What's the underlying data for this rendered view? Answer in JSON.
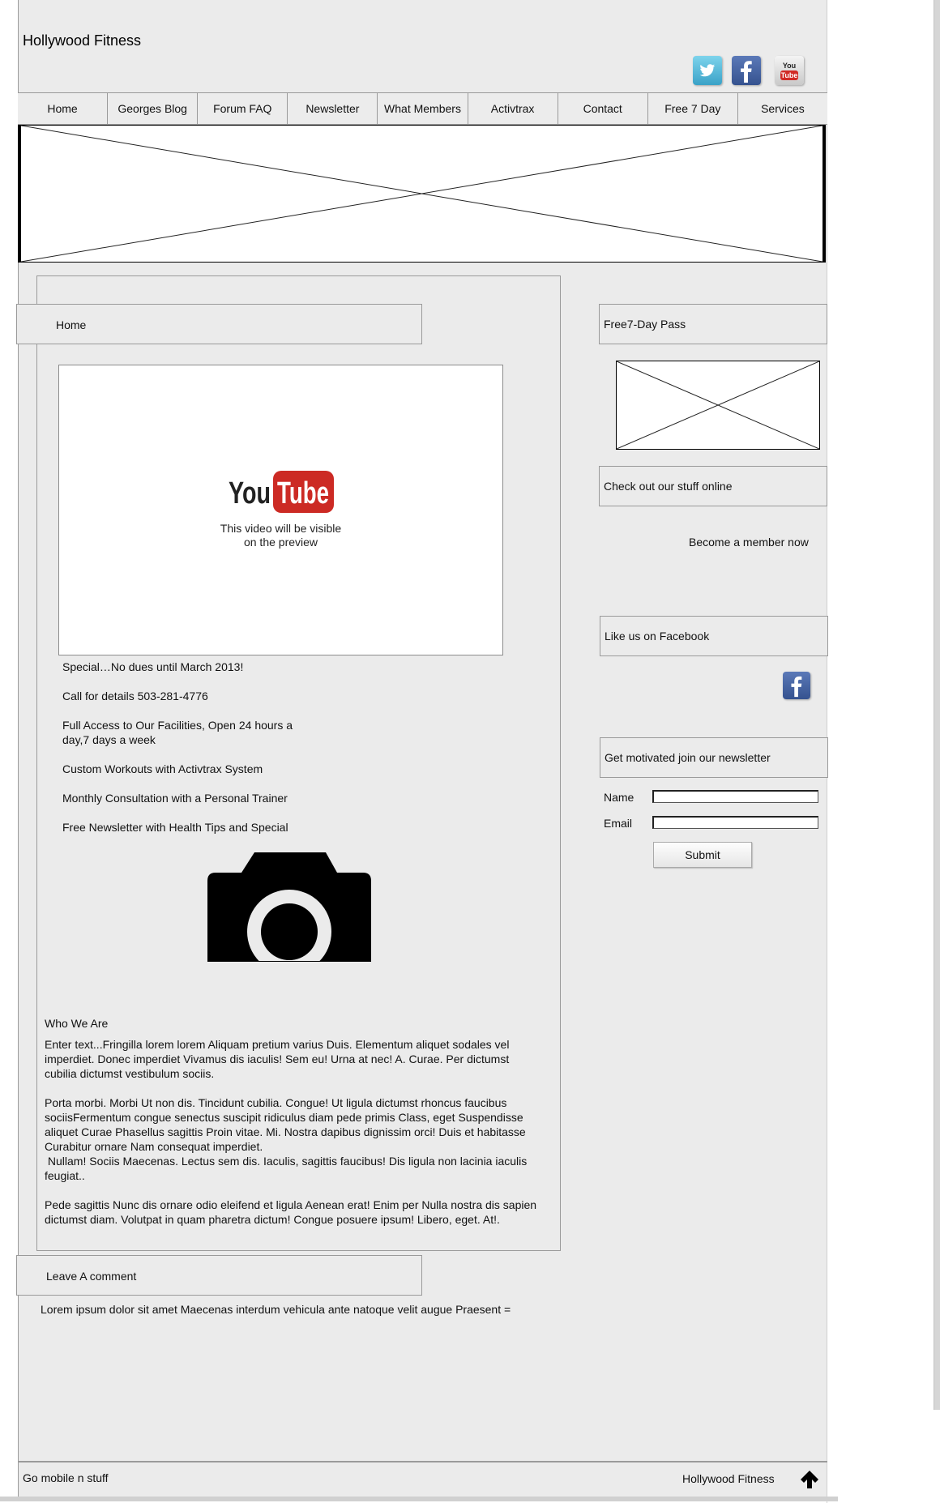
{
  "site": {
    "title": "Hollywood Fitness"
  },
  "social": [
    "twitter-icon",
    "facebook-icon",
    "youtube-icon"
  ],
  "nav": {
    "items": [
      {
        "label": "Home"
      },
      {
        "label": "Georges Blog"
      },
      {
        "label": "Forum FAQ"
      },
      {
        "label": "Newsletter"
      },
      {
        "label": "What Members"
      },
      {
        "label": "Activtrax"
      },
      {
        "label": "Contact"
      },
      {
        "label": "Free 7 Day"
      },
      {
        "label": "Services"
      }
    ]
  },
  "main": {
    "tab_label": "Home",
    "video": {
      "logo": "You Tube",
      "caption_line1": "This video will be visible",
      "caption_line2": "on the preview"
    },
    "features": [
      "Special…No dues until March 2013!",
      "Call for details  503-281-4776",
      "Full Access to Our Facilities, Open 24 hours a day,7 days a week",
      "Custom Workouts with Activtrax System",
      "Monthly Consultation with a Personal Trainer",
      "Free Newsletter with Health Tips and Special"
    ],
    "who_heading": "Who We Are",
    "paragraphs": [
      "Enter text...Fringilla lorem lorem Aliquam pretium varius Duis. Elementum aliquet sodales vel imperdiet. Donec imperdiet Vivamus dis iaculis! Sem eu! Urna at nec! A. Curae. Per dictumst cubilia dictumst vestibulum sociis.",
      "Porta morbi. Morbi Ut non dis. Tincidunt cubilia. Congue! Ut ligula dictumst rhoncus faucibus sociisFermentum congue senectus suscipit ridiculus diam pede primis Class, eget Suspendisse aliquet Curae Phasellus sagittis Proin vitae. Mi. Nostra dapibus dignissim orci! Duis et habitasse Curabitur ornare Nam consequat imperdiet.\n Nullam! Sociis Maecenas. Lectus sem dis. Iaculis, sagittis faucibus! Dis ligula non lacinia iaculis feugiat..",
      "Pede sagittis Nunc dis ornare odio eleifend et ligula Aenean erat! Enim per Nulla nostra dis sapien dictumst diam. Volutpat in quam pharetra dictum! Congue posuere ipsum! Libero, eget. At!."
    ],
    "comment_tab": "Leave A comment",
    "comment_text": "Lorem ipsum dolor sit amet Maecenas interdum vehicula ante natoque velit augue Praesent ="
  },
  "sidebar": {
    "pass_title": "Free7-Day Pass",
    "stuff_title": "Check out our stuff online",
    "member_link": "Become a member now",
    "facebook_title": "Like us on Facebook",
    "newsletter_title": "Get motivated join our newsletter",
    "name_label": "Name",
    "email_label": "Email",
    "name_value": "",
    "email_value": "",
    "submit_label": "Submit"
  },
  "footer": {
    "left": "Go mobile n stuff",
    "right": "Hollywood Fitness"
  }
}
